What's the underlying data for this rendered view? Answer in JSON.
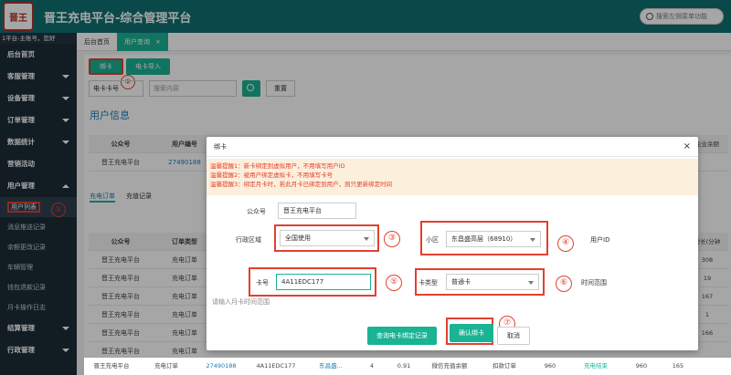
{
  "header": {
    "logo_text": "晋王",
    "title": "晋王充电平台-综合管理平台",
    "search_placeholder": "搜索左侧菜单功能"
  },
  "sidebar": {
    "user": "1平台-主账号，您好",
    "items": [
      {
        "label": "后台首页"
      },
      {
        "label": "客服管理"
      },
      {
        "label": "设备管理"
      },
      {
        "label": "订单管理"
      },
      {
        "label": "数据统计"
      },
      {
        "label": "营销活动"
      },
      {
        "label": "用户管理"
      }
    ],
    "sub_items": [
      {
        "label": "用户列表"
      },
      {
        "label": "消息推送记录"
      },
      {
        "label": "余额更改记录"
      },
      {
        "label": "车辆管理"
      },
      {
        "label": "钱包退款记录"
      },
      {
        "label": "月卡操作日志"
      }
    ],
    "bottom_items": [
      {
        "label": "结算管理"
      },
      {
        "label": "行政管理"
      }
    ],
    "bubble": "①"
  },
  "tabs": [
    {
      "label": "后台首页"
    },
    {
      "label": "用户查询",
      "close": "×"
    }
  ],
  "toolbar": {
    "bind_card": "绑卡",
    "import_card": "电卡导入",
    "bubble": "②"
  },
  "search": {
    "type_select": "电卡卡号",
    "placeholder": "搜索内容",
    "reset": "重置"
  },
  "section_title": "用户信息",
  "bg_table": {
    "headers": [
      "公众号",
      "用户编号"
    ],
    "row": [
      "晋王充电平台",
      "27490188"
    ],
    "right_header": "企业余额"
  },
  "sub_tabs": [
    "充电订单",
    "充值记录"
  ],
  "bg_orders": {
    "headers": [
      "公众号",
      "订单类型"
    ],
    "rows": [
      [
        "晋王充电平台",
        "充电订单"
      ],
      [
        "晋王充电平台",
        "充电订单"
      ],
      [
        "晋王充电平台",
        "充电订单"
      ],
      [
        "晋王充电平台",
        "充电订单"
      ],
      [
        "晋王充电平台",
        "充电订单"
      ],
      [
        "晋王充电平台",
        "充电订单"
      ]
    ],
    "right_header": "时长(分钟",
    "right_values": [
      "308",
      "19",
      "167",
      "1",
      "166"
    ]
  },
  "modal": {
    "title": "绑卡",
    "close": "×",
    "tips": [
      "温馨提醒1：新卡绑定到虚拟用户，不用填写用户ID",
      "温馨提醒2：被用户绑定虚拟卡，不用填写卡号",
      "温馨提醒3：绑定月卡时，若此月卡已绑定到用户，则只更新绑定时间"
    ],
    "form": {
      "account_label": "公众号",
      "account_value": "晋王充电平台",
      "region_label": "行政区域",
      "region_value": "全国使用",
      "community_label": "小区",
      "community_value": "东昌盛高层（68910）",
      "user_id_label": "用户ID",
      "card_no_label": "卡号",
      "card_no_value": "4A11EDC177",
      "card_type_label": "卡类型",
      "card_type_value": "普通卡",
      "time_range_label": "时间范围",
      "date_placeholder": "请输入月卡时间范围"
    },
    "buttons": {
      "query": "查询电卡绑定记录",
      "confirm": "确认绑卡",
      "cancel": "取消"
    },
    "bubbles": [
      "③",
      "④",
      "⑤",
      "⑥",
      "⑦"
    ]
  },
  "bottom_row": [
    "晋王充电平台",
    "充电订单",
    "27490188",
    "4A11EDC177",
    "东昌盛...",
    "4",
    "0.91",
    "微信充值余额",
    "扣款订单",
    "960",
    "充电结束",
    "960",
    "165"
  ]
}
